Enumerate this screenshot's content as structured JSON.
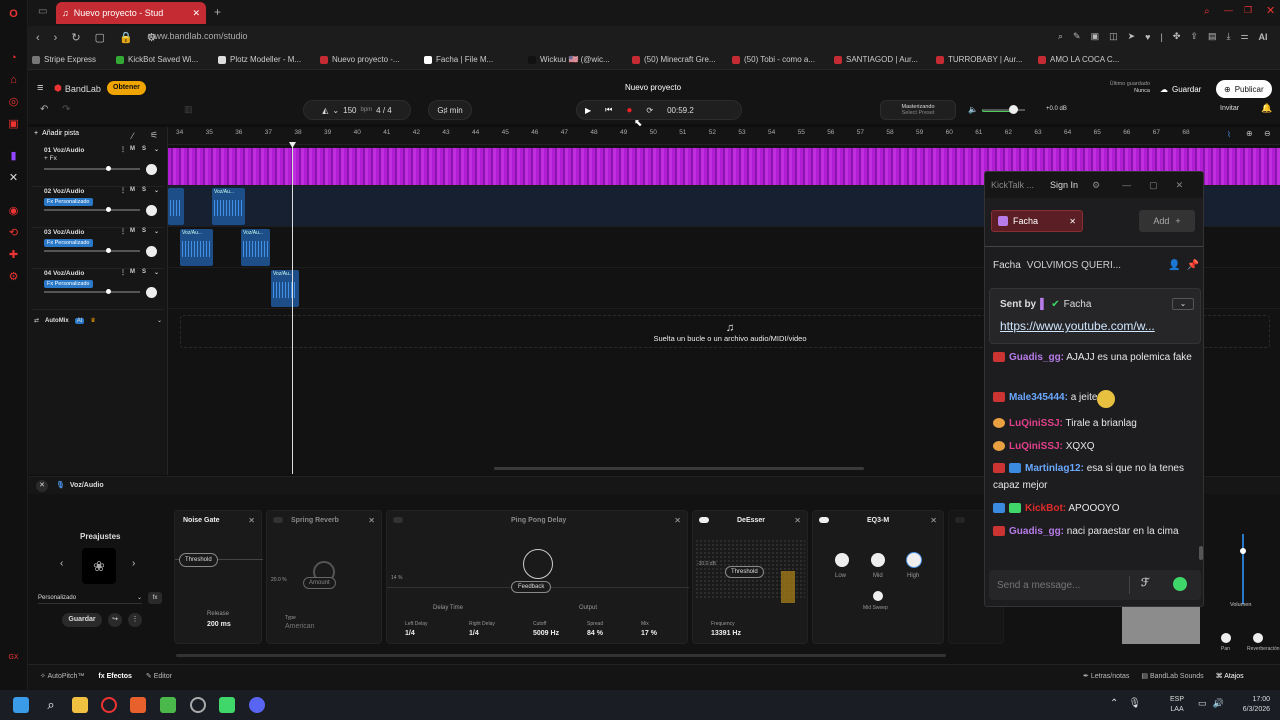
{
  "browser": {
    "tab_title": "Nuevo proyecto - Stud",
    "url": "www.bandlab.com/studio",
    "bookmarks": [
      "Stripe Express",
      "KickBot Saved Wi...",
      "Plotz Modeller - M...",
      "Nuevo proyecto -...",
      "Facha | File M...",
      "Wickuu 🇺🇸 (@wic...",
      "(50) Minecraft Gre...",
      "(50) Tobi - como a...",
      "SANTIAGOD | Aur...",
      "TURROBABY | Aur...",
      "AMO LA COCA C..."
    ]
  },
  "header": {
    "brand": "BandLab",
    "get_label": "Obtener",
    "project_title": "Nuevo proyecto",
    "last_saved_label": "Último guardado",
    "last_saved_value": "Nunca",
    "save_label": "Guardar",
    "publish_label": "Publicar",
    "invite_label": "Invitar"
  },
  "transport": {
    "bpm": "150",
    "bpm_unit": "bpm",
    "signature": "4 / 4",
    "key": "G♯ min",
    "time": "00:59.2",
    "mastering_label": "Masterizando",
    "mastering_sub": "Select Preset",
    "level": "+0.0 dB"
  },
  "track_panel": {
    "add_track_label": "Añadir pista",
    "tracks": [
      {
        "name": "01  Voz/Audio",
        "fx": "+ Fx"
      },
      {
        "name": "02  Voz/Audio",
        "fx": "Fx Personalizado"
      },
      {
        "name": "03  Voz/Audio",
        "fx": "Fx Personalizado"
      },
      {
        "name": "04  Voz/Audio",
        "fx": "Fx Personalizado"
      }
    ],
    "mute_label": "M",
    "solo_label": "S",
    "automix_label": "AutoMix"
  },
  "ruler": [
    "34",
    "35",
    "36",
    "37",
    "38",
    "39",
    "40",
    "41",
    "42",
    "43",
    "44",
    "45",
    "46",
    "47",
    "48",
    "49",
    "50",
    "51",
    "52",
    "53",
    "54",
    "55",
    "56",
    "57",
    "58",
    "59",
    "60",
    "61",
    "62",
    "63",
    "64",
    "65",
    "66",
    "67",
    "68"
  ],
  "clips": {
    "label": "Voz/Au..."
  },
  "drop_hint": "Suelta un bucle o un archivo audio/MIDI/video",
  "fx": {
    "track_label": "Voz/Audio",
    "presets_label": "Preajustes",
    "preset_value": "Personalizado",
    "save_label": "Guardar",
    "noise_gate": {
      "title": "Noise Gate",
      "threshold": "Threshold",
      "release_label": "Release",
      "release_value": "200 ms"
    },
    "spring_reverb": {
      "title": "Spring Reverb",
      "amount": "Amount",
      "pct": "20.0 %",
      "type_label": "Type",
      "type_value": "American"
    },
    "ping_pong": {
      "title": "Ping Pong Delay",
      "feedback": "Feedback",
      "pct": "14 %",
      "delay_time": "Delay Time",
      "output": "Output",
      "left_label": "Left Delay",
      "left_value": "1/4",
      "right_label": "Right Delay",
      "right_value": "1/4",
      "cutoff_label": "Cutoff",
      "cutoff_value": "5009 Hz",
      "spread_label": "Spread",
      "spread_value": "84 %",
      "mix_label": "Mix",
      "mix_value": "17 %"
    },
    "deesser": {
      "title": "DeEsser",
      "threshold": "Threshold",
      "db": "-30.0 dB",
      "freq_label": "Frequency",
      "freq_value": "13391 Hz"
    },
    "eq": {
      "title": "EQ3-M",
      "low": "Low",
      "mid": "Mid",
      "high": "High",
      "sweep": "Mid Sweep"
    },
    "volume_label": "Volumen",
    "pan_label": "Pan",
    "reverb_label": "Reverberación"
  },
  "statusbar": {
    "autopitch": "AutoPitch™",
    "effects": "Efectos",
    "editor": "Editor",
    "lyrics": "Letras/notas",
    "sounds": "BandLab Sounds",
    "shortcuts": "Atajos"
  },
  "kicktalk": {
    "title": "KickTalk ...",
    "sign_in": "Sign In",
    "channel": "Facha",
    "add_label": "Add",
    "pinned_user": "Facha",
    "pinned_text": "VOLVIMOS QUERI...",
    "sent_by": "Sent by",
    "sent_user": "Facha",
    "link": "https://www.youtube.com/w...",
    "messages": [
      {
        "user": "Guadis_gg:",
        "text": "AJAJJ es una polemica fake",
        "color": "#b77ce8"
      },
      {
        "user": "Male345444:",
        "text": "a  jeiters",
        "color": "#6aa8ff"
      },
      {
        "user": "LuQiniSSJ:",
        "text": "Tirale a brianlag",
        "color": "#e0408a"
      },
      {
        "user": "LuQiniSSJ:",
        "text": "XQXQ",
        "color": "#e0408a"
      },
      {
        "user": "Martinlag12:",
        "text": "esa si que no la tenes capaz mejor",
        "color": "#6aa8ff"
      },
      {
        "user": "KickBot:",
        "text": "APOOOYO",
        "color": "#e02a2a"
      },
      {
        "user": "Guadis_gg:",
        "text": "naci paraestar en la cima",
        "color": "#b77ce8"
      }
    ],
    "input_placeholder": "Send a message..."
  },
  "taskbar": {
    "lang": "ESP",
    "lang2": "LAA",
    "time": "17:00",
    "date": "6/3/2026"
  }
}
